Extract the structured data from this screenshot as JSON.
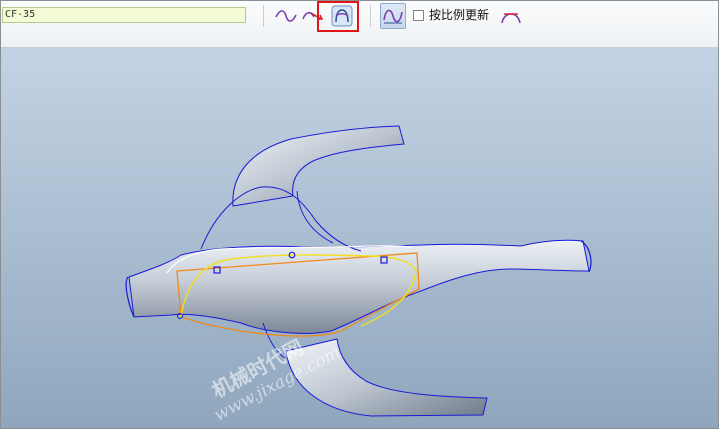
{
  "toolbar": {
    "name_value": "CF-35",
    "checkbox_label": "按比例更新",
    "checkbox_checked": false
  },
  "watermark": {
    "line1": "机械时代网",
    "line2": "www.jixage.com"
  },
  "colors": {
    "name_field_bg": "#f3fcd7",
    "highlight_border": "#e0161a",
    "curve_blue": "#1a1ad6",
    "curve_yellow": "#f0e020",
    "curve_orange": "#f08a18"
  },
  "icons": [
    "wave-curve-icon",
    "curve-arrow-icon",
    "surface-shape-icon",
    "curve-edit-icon",
    "arc-shape-icon"
  ]
}
